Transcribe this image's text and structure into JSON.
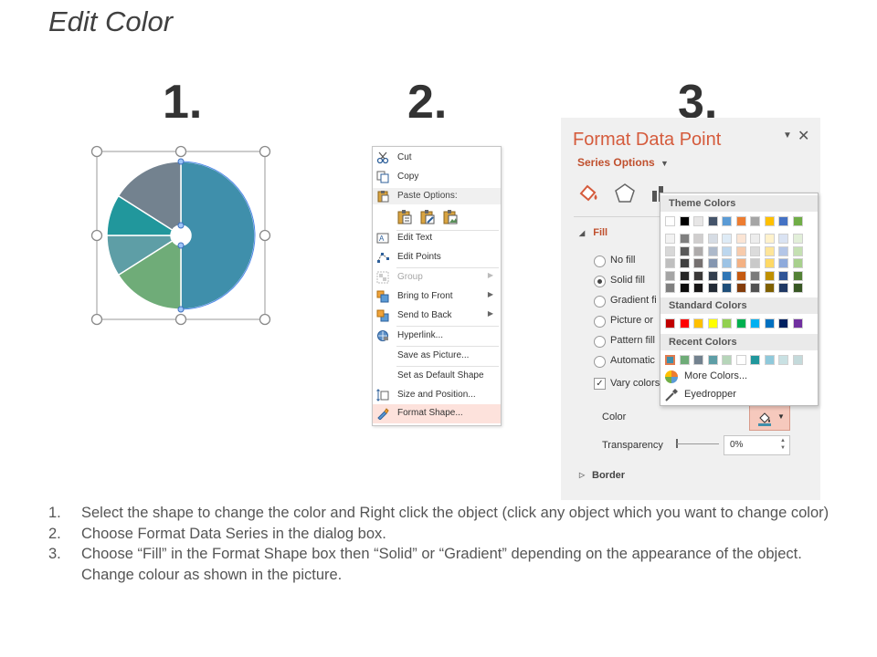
{
  "slide": {
    "title": "Edit Color"
  },
  "steps": [
    "1.",
    "2.",
    "3."
  ],
  "pie": {
    "slices": [
      {
        "value": 50,
        "color": "#3f8fab"
      },
      {
        "value": 16,
        "color": "#6fac78"
      },
      {
        "value": 9,
        "color": "#5e9ea6"
      },
      {
        "value": 9,
        "color": "#21979c"
      },
      {
        "value": 16,
        "color": "#73828f"
      }
    ]
  },
  "context_menu": {
    "cut": "Cut",
    "copy": "Copy",
    "paste_options": "Paste Options:",
    "edit_text": "Edit Text",
    "edit_points": "Edit Points",
    "group": "Group",
    "bring_to_front": "Bring to Front",
    "send_to_back": "Send to Back",
    "hyperlink": "Hyperlink...",
    "save_as_picture": "Save as Picture...",
    "set_default_shape": "Set as Default Shape",
    "size_and_position": "Size and Position...",
    "format_shape": "Format Shape..."
  },
  "format_panel": {
    "title": "Format Data Point",
    "series_options": "Series Options",
    "fill_header": "Fill",
    "options": [
      "No fill",
      "Solid fill",
      "Gradient fi",
      "Picture or",
      "Pattern fill",
      "Automatic"
    ],
    "selected_option": "Solid fill",
    "vary_colors": "Vary colors",
    "color_label": "Color",
    "transparency_label": "Transparency",
    "transparency_value": "0%",
    "border_header": "Border",
    "accent": "#d55b3c"
  },
  "color_dropdown": {
    "theme_colors_label": "Theme Colors",
    "standard_colors_label": "Standard Colors",
    "recent_colors_label": "Recent Colors",
    "more_colors": "More Colors...",
    "eyedropper": "Eyedropper",
    "theme_top": [
      "#ffffff",
      "#000000",
      "#e7e6e6",
      "#44546a",
      "#5b9bd5",
      "#ed7d31",
      "#a5a5a5",
      "#ffc000",
      "#4472c4",
      "#70ad47"
    ],
    "theme_shades": [
      [
        "#f2f2f2",
        "#7f7f7f",
        "#d0cece",
        "#d6dce4",
        "#deebf6",
        "#fbe5d5",
        "#ededed",
        "#fff2cc",
        "#dae3f3",
        "#e2efd9"
      ],
      [
        "#d8d8d8",
        "#595959",
        "#aeabab",
        "#adb9ca",
        "#bdd7ee",
        "#f7cbac",
        "#dbdbdb",
        "#fee599",
        "#b4c6e7",
        "#c5e0b3"
      ],
      [
        "#bfbfbf",
        "#3f3f3f",
        "#757070",
        "#8496b0",
        "#9cc3e5",
        "#f4b183",
        "#c9c9c9",
        "#ffd965",
        "#8eaadb",
        "#a8d08d"
      ],
      [
        "#a5a5a5",
        "#262626",
        "#3a3838",
        "#333f4f",
        "#2e75b5",
        "#c55a11",
        "#7b7b7b",
        "#bf9000",
        "#2f5496",
        "#538135"
      ],
      [
        "#7f7f7f",
        "#0c0c0c",
        "#171616",
        "#222a35",
        "#1e4e79",
        "#833c0b",
        "#525252",
        "#7f6000",
        "#1f3864",
        "#375623"
      ]
    ],
    "standard": [
      "#c00000",
      "#ff0000",
      "#ffc000",
      "#ffff00",
      "#92d050",
      "#00b050",
      "#00b0f0",
      "#0070c0",
      "#002060",
      "#7030a0"
    ],
    "recent": [
      "#3f8fab",
      "#6fac78",
      "#73828f",
      "#5e9ea6",
      "#b6d5b9",
      "#ffffff",
      "#21979c",
      "#8fc9db",
      "#c9e1e3",
      "#c4dadb"
    ]
  },
  "instructions": [
    {
      "num": "1.",
      "text": "Select the shape to change the color and Right click the object (click any object which you want to change color)"
    },
    {
      "num": "2.",
      "text": "Choose Format Data Series in the dialog box."
    },
    {
      "num": "3.",
      "text": "Choose “Fill” in the Format Shape box then “Solid” or “Gradient” depending on the appearance of the object. Change colour as shown in the picture."
    }
  ]
}
